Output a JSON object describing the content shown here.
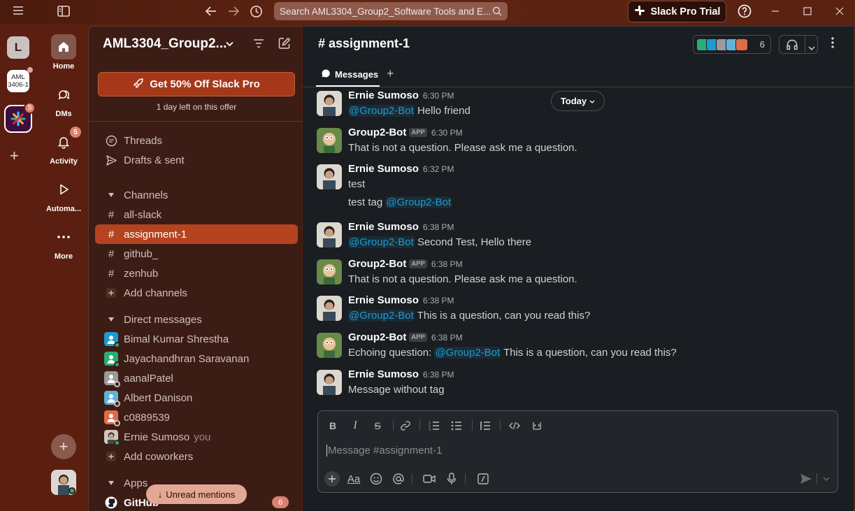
{
  "titlebar": {
    "search_placeholder": "Search AML3304_Group2_Software Tools and E...",
    "trial_label": "Slack Pro Trial"
  },
  "workspaces": {
    "first_initial": "L",
    "second_label_1": "AML",
    "second_label_2": "3406-1",
    "active_badge": "5"
  },
  "nav": {
    "home": "Home",
    "dms": "DMs",
    "activity": "Activity",
    "activity_badge": "5",
    "automations": "Automa...",
    "more": "More"
  },
  "sidebar": {
    "workspace_name": "AML3304_Group2...",
    "promo_label": "Get 50% Off Slack Pro",
    "promo_sub": "1 day left on this offer",
    "threads": "Threads",
    "drafts": "Drafts & sent",
    "channels_header": "Channels",
    "channels": [
      {
        "name": "all-slack"
      },
      {
        "name": "assignment-1"
      },
      {
        "name": "github_"
      },
      {
        "name": "zenhub"
      }
    ],
    "add_channels": "Add channels",
    "dm_header": "Direct messages",
    "dms": [
      {
        "name": "Bimal Kumar Shrestha",
        "color": "#1d9bd1"
      },
      {
        "name": "Jayachandhran Saravanan",
        "color": "#2bac76"
      },
      {
        "name": "aanalPatel",
        "color": "#9a9a9a"
      },
      {
        "name": "Albert Danison",
        "color": "#5fb3d9"
      },
      {
        "name": "c0889539",
        "color": "#e06b4a"
      },
      {
        "name": "Ernie Sumoso",
        "color": "#cfc8bf"
      }
    ],
    "you_label": "you",
    "add_coworkers": "Add coworkers",
    "apps_header": "Apps",
    "github_app": "GitHub",
    "github_badge": "6",
    "unread_mentions": "Unread mentions"
  },
  "channel": {
    "title": "# assignment-1",
    "member_count": "6",
    "tab_messages": "Messages",
    "today_label": "Today"
  },
  "messages": [
    {
      "author": "Ernie Sumoso",
      "time": "6:30 PM",
      "is_app": false,
      "mention": "@Group2-Bot",
      "text": " Hello friend"
    },
    {
      "author": "Group2-Bot",
      "time": "6:30 PM",
      "is_app": true,
      "mention": "",
      "text": "That is not a question. Please ask me a question."
    },
    {
      "author": "Ernie Sumoso",
      "time": "6:32 PM",
      "is_app": false,
      "mention": "",
      "text": "test"
    },
    {
      "author": "",
      "time": "",
      "is_app": false,
      "prefix": "test tag ",
      "mention": "@Group2-Bot",
      "text": ""
    },
    {
      "author": "Ernie Sumoso",
      "time": "6:38 PM",
      "is_app": false,
      "mention": "@Group2-Bot",
      "text": " Second Test, Hello there"
    },
    {
      "author": "Group2-Bot",
      "time": "6:38 PM",
      "is_app": true,
      "mention": "",
      "text": "That is not a question. Please ask me a question."
    },
    {
      "author": "Ernie Sumoso",
      "time": "6:38 PM",
      "is_app": false,
      "mention": "@Group2-Bot",
      "text": " This is a question, can you read this?"
    },
    {
      "author": "Group2-Bot",
      "time": "6:38 PM",
      "is_app": true,
      "prefix": "Echoing question: ",
      "mention": "@Group2-Bot",
      "text": " This is a question, can you read this?"
    },
    {
      "author": "Ernie Sumoso",
      "time": "6:38 PM",
      "is_app": false,
      "mention": "",
      "text": "Message without tag"
    }
  ],
  "app_tag": "APP",
  "composer": {
    "placeholder": "Message #assignment-1"
  },
  "colors": {
    "accent_active": "#b5431f",
    "promo": "#a6381a",
    "mention": "#1d9bd1",
    "online": "#2bac76"
  }
}
